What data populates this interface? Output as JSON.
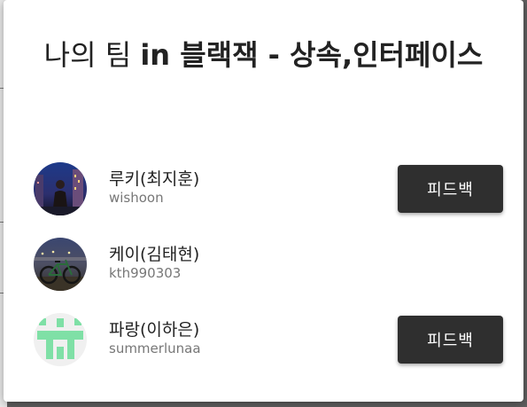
{
  "dialog": {
    "title_prefix": "나의 팀 ",
    "title_bold": "in 블랙잭 - 상속,인터페이스"
  },
  "members": [
    {
      "name": "루키(최지훈)",
      "username": "wishoon",
      "feedback_label": "피드백",
      "avatar_icon": "night-city-photo-avatar"
    },
    {
      "name": "케이(김태현)",
      "username": "kth990303",
      "avatar_icon": "bicycle-photo-avatar"
    },
    {
      "name": "파랑(이하은)",
      "username": "summerlunaa",
      "feedback_label": "피드백",
      "avatar_icon": "identicon-avatar",
      "avatar_color": "#7fe0a6"
    }
  ],
  "colors": {
    "button_bg": "#2f2f2f",
    "overlay": "#5f5f5f"
  }
}
